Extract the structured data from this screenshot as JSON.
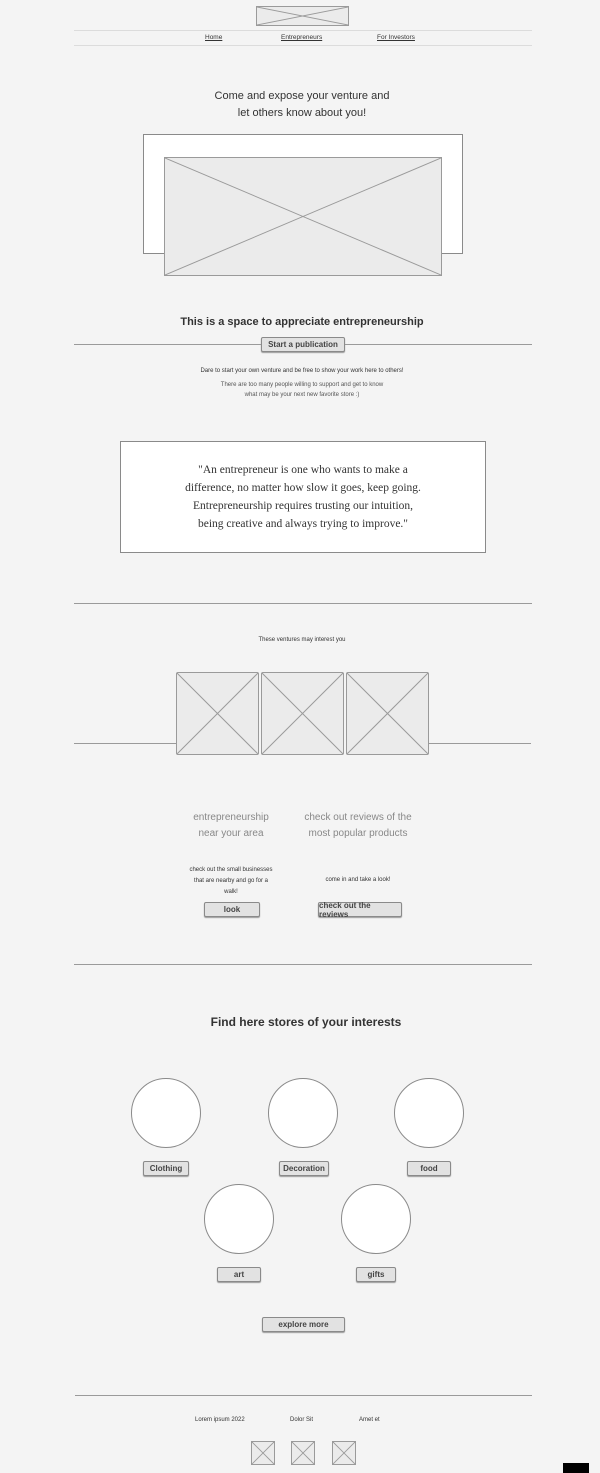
{
  "nav": {
    "items": [
      "Home",
      "Entrepreneurs",
      "For Investors"
    ]
  },
  "hero": {
    "headline_line1": "Come and expose your venture and",
    "headline_line2": "let others know about you!"
  },
  "space": {
    "title": "This is a space to appreciate entrepreneurship",
    "publish_button": "Start a publication",
    "line1": "Dare to start your own venture and be free to show your work here to others!",
    "line2a": "There are too many people willing to support and get to know",
    "line2b": "what may be your next new favorite store :)"
  },
  "quote": {
    "text": "\"An entrepreneur is one who wants to make a difference, no matter how slow it goes, keep going. Entrepreneurship requires trusting our intuition, being creative and always trying to improve.\""
  },
  "ventures": {
    "caption": "These ventures may interest you"
  },
  "features": {
    "left": {
      "title_line1": "entrepreneurship",
      "title_line2": "near your area",
      "desc_line1": "check out the small businesses",
      "desc_line2": "that are nearby and go for a",
      "desc_line3": "walk!",
      "button": "look"
    },
    "right": {
      "title_line1": "check out reviews of the",
      "title_line2": "most popular products",
      "desc": "come in and take a look!",
      "button": "check out the reviews"
    }
  },
  "stores": {
    "title": "Find here stores of your interests",
    "categories": [
      "Clothing",
      "Decoration",
      "food",
      "art",
      "gifts"
    ],
    "explore_button": "explore more"
  },
  "footer": {
    "items": [
      "Lorem ipsum 2022",
      "Dolor Sit",
      "Amet et"
    ]
  },
  "colors": {
    "background": "#f4f4f4",
    "placeholder": "#ebebeb",
    "line": "#9a9a9a",
    "button": "#e2e2e2"
  }
}
